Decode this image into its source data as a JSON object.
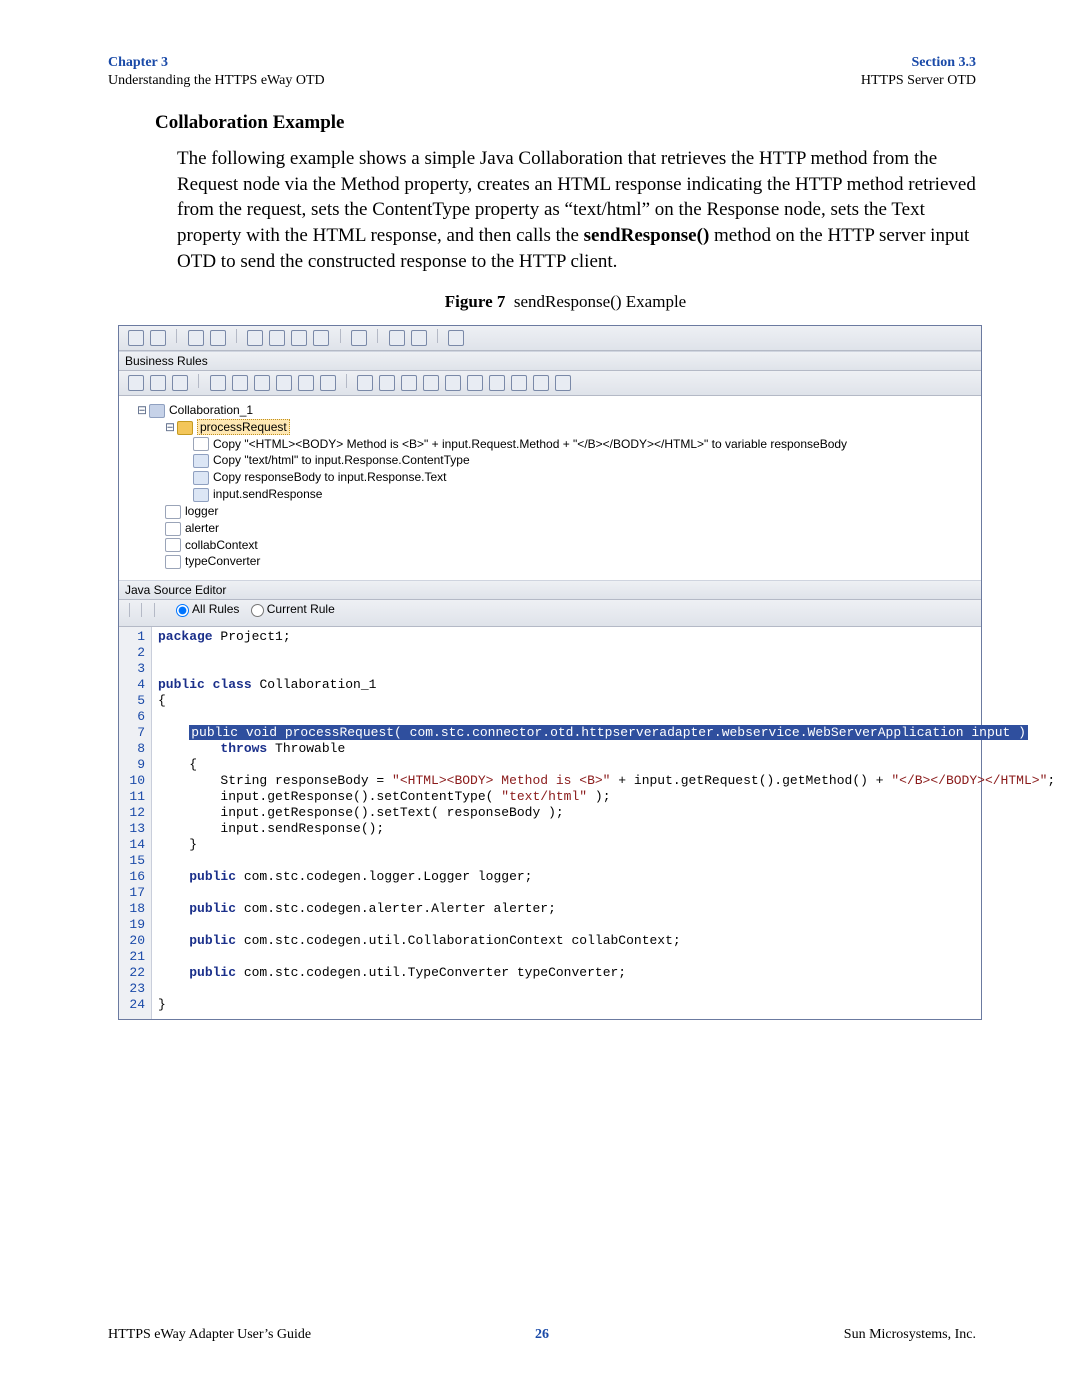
{
  "header": {
    "chapter": "Chapter 3",
    "chapterSub": "Understanding the HTTPS eWay OTD",
    "section": "Section 3.3",
    "sectionSub": "HTTPS Server OTD"
  },
  "heading": "Collaboration Example",
  "para_pre": "The following example shows a simple Java Collaboration that retrieves the HTTP method from the Request node via the Method property, creates an HTML response indicating the HTTP method retrieved from the request, sets the ContentType property as “text/html” on the Response node, sets the Text property with the HTML response, and then calls the ",
  "para_bold": "sendResponse()",
  "para_post": " method on the HTTP server input OTD to send the constructed response to the HTTP client.",
  "figure": {
    "label": "Figure 7",
    "caption": "sendResponse() Example"
  },
  "ide": {
    "panels": {
      "businessRules": "Business Rules",
      "javaSourceEditor": "Java Source Editor"
    },
    "tree": {
      "root": "Collaboration_1",
      "method": "processRequest",
      "rule1": "Copy \"<HTML><BODY> Method is <B>\" + input.Request.Method + \"</B></BODY></HTML>\" to variable responseBody",
      "rule2": "Copy \"text/html\" to input.Response.ContentType",
      "rule3": "Copy responseBody to input.Response.Text",
      "rule4": "input.sendResponse",
      "n_logger": "logger",
      "n_alerter": "alerter",
      "n_collab": "collabContext",
      "n_type": "typeConverter"
    },
    "rules": {
      "all": "All Rules",
      "current": "Current Rule"
    },
    "code": {
      "l1_kw": "package",
      "l1_rest": " Project1;",
      "l4_kw1": "public",
      "l4_kw2": "class",
      "l4_rest": " Collaboration_1",
      "l5": "{",
      "l7_hl": "public void processRequest( com.stc.connector.otd.httpserveradapter.webservice.WebServerApplication input )",
      "l8_kw": "throws",
      "l8_rest": " Throwable",
      "l9": "    {",
      "l10_a": "        String responseBody = ",
      "l10_s1": "\"<HTML><BODY> Method is <B>\"",
      "l10_b": " + input.getRequest().getMethod() + ",
      "l10_s2": "\"</B></BODY></HTML>\"",
      "l10_c": ";",
      "l11_a": "        input.getResponse().setContentType( ",
      "l11_s": "\"text/html\"",
      "l11_b": " );",
      "l12": "        input.getResponse().setText( responseBody );",
      "l13": "        input.sendResponse();",
      "l14": "    }",
      "l16_kw": "public",
      "l16_rest": " com.stc.codegen.logger.Logger logger;",
      "l18_kw": "public",
      "l18_rest": " com.stc.codegen.alerter.Alerter alerter;",
      "l20_kw": "public",
      "l20_rest": " com.stc.codegen.util.CollaborationContext collabContext;",
      "l22_kw": "public",
      "l22_rest": " com.stc.codegen.util.TypeConverter typeConverter;",
      "l24": "}"
    }
  },
  "footer": {
    "left": "HTTPS eWay Adapter User’s Guide",
    "page": "26",
    "right": "Sun Microsystems, Inc."
  }
}
